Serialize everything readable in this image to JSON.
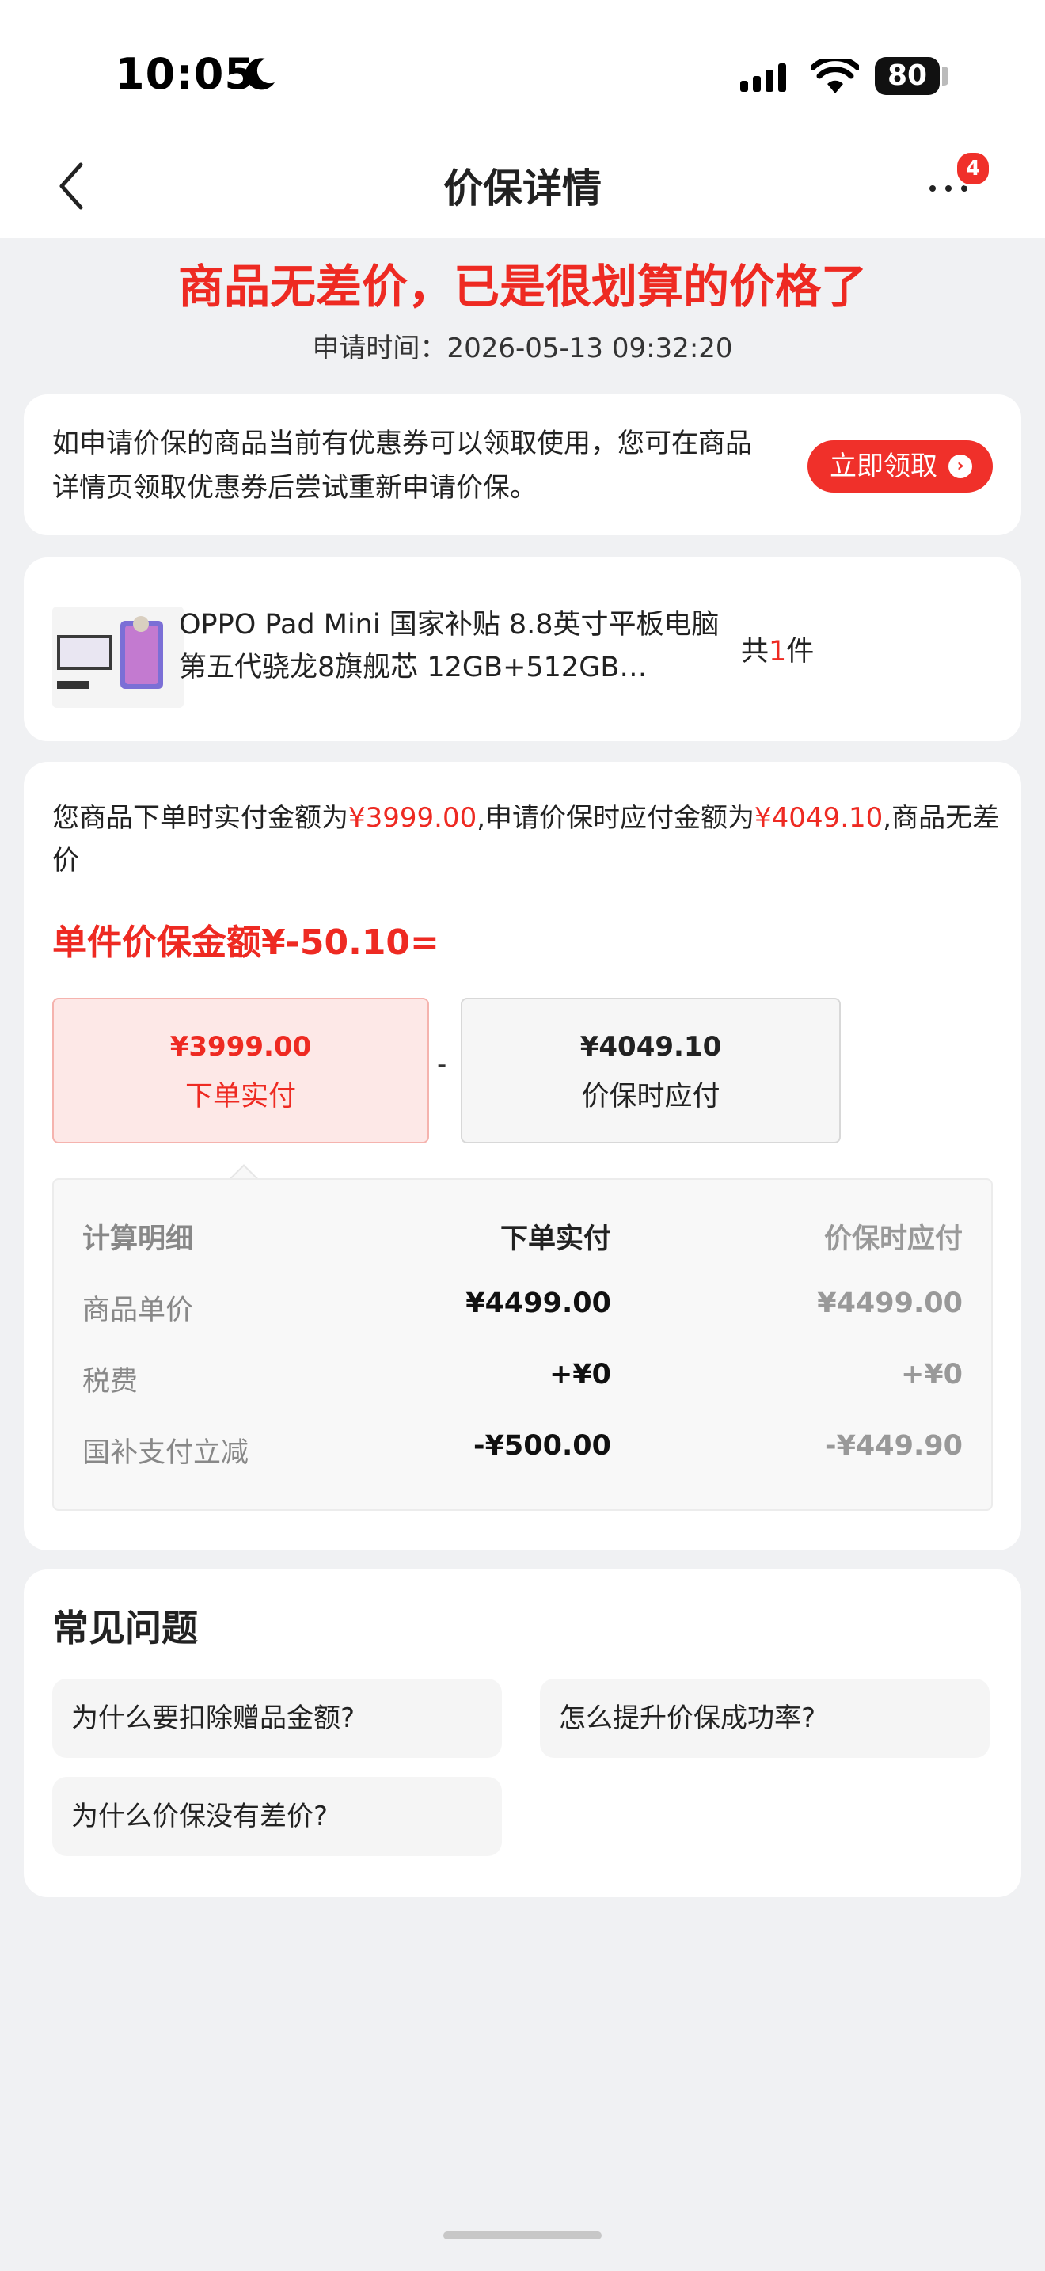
{
  "status_bar": {
    "time": "10:05",
    "battery": "80"
  },
  "nav": {
    "title": "价保详情",
    "badge": "4"
  },
  "headline": "商品无差价，已是很划算的价格了",
  "apply_time": "申请时间：2026-05-13 09:32:20",
  "coupon": {
    "text": "如申请价保的商品当前有优惠券可以领取使用，您可在商品详情页领取优惠券后尝试重新申请价保。",
    "button": "立即领取"
  },
  "product": {
    "name": "OPPO Pad Mini 国家补贴 8.8英寸平板电脑 第五代骁龙8旗舰芯 12GB+512GB…",
    "count_prefix": "共",
    "count": "1",
    "count_suffix": "件"
  },
  "detail": {
    "desc_part1": "您商品下单时实付金额为",
    "paid": "¥3999.00",
    "desc_part2": ",申请价保时应付金额为",
    "due": "¥4049.10",
    "desc_part3": ",商品无差价",
    "unit_amount": "单件价保金额¥-50.10=",
    "box_paid_value": "¥3999.00",
    "box_paid_label": "下单实付",
    "minus": "-",
    "box_due_value": "¥4049.10",
    "box_due_label": "价保时应付",
    "calc": {
      "headers": [
        "计算明细",
        "下单实付",
        "价保时应付"
      ],
      "rows": [
        [
          "商品单价",
          "¥4499.00",
          "¥4499.00"
        ],
        [
          "税费",
          "+¥0",
          "+¥0"
        ],
        [
          "国补支付立减",
          "-¥500.00",
          "-¥449.90"
        ]
      ]
    }
  },
  "faq": {
    "title": "常见问题",
    "items": [
      "为什么要扣除赠品金额?",
      "怎么提升价保成功率?",
      "为什么价保没有差价?"
    ]
  }
}
